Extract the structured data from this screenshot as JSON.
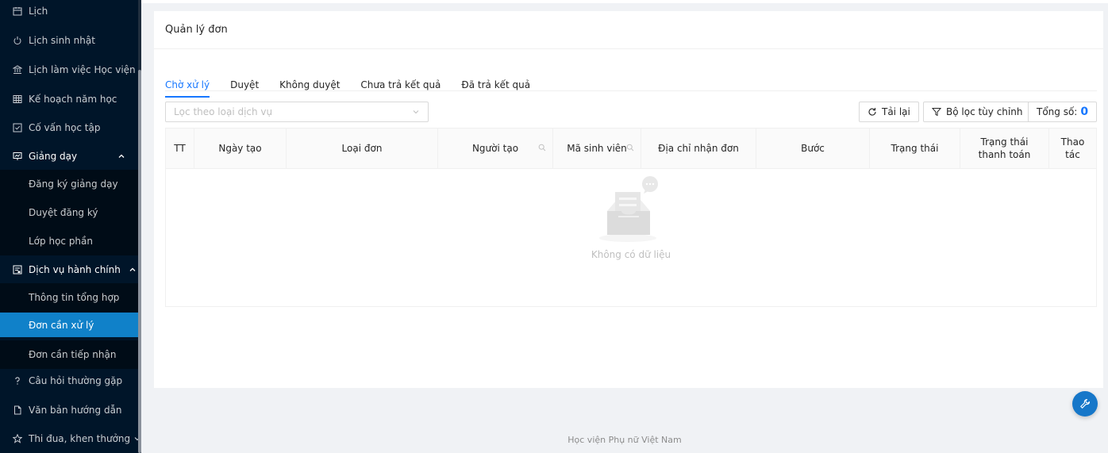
{
  "colors": {
    "sidebar_bg": "#001529",
    "sidebar_active": "#1081c9",
    "accent": "#1677ff"
  },
  "sidebar": {
    "items": [
      {
        "label": "Lịch",
        "icon": "calendar-icon"
      },
      {
        "label": "Lịch sinh nhật",
        "icon": "power-icon"
      },
      {
        "label": "Lịch làm việc Học viện",
        "icon": "bank-icon"
      },
      {
        "label": "Kế hoạch năm học",
        "icon": "table-icon"
      },
      {
        "label": "Cố vấn học tập",
        "icon": "check-square-icon"
      },
      {
        "label": "Giảng dạy",
        "icon": "presentation-icon"
      },
      {
        "label": "Đăng ký giảng dạy"
      },
      {
        "label": "Duyệt đăng ký"
      },
      {
        "label": "Lớp học phần"
      },
      {
        "label": "Dịch vụ hành chính",
        "icon": "form-icon"
      },
      {
        "label": "Thông tin tổng hợp"
      },
      {
        "label": "Đơn cần xử lý"
      },
      {
        "label": "Đơn cần tiếp nhận"
      },
      {
        "label": "Câu hỏi thường gặp",
        "icon": "question-icon"
      },
      {
        "label": "Văn bản hướng dẫn",
        "icon": "file-icon"
      },
      {
        "label": "Thi đua, khen thưởng",
        "icon": "star-icon"
      }
    ]
  },
  "page": {
    "title": "Quản lý đơn",
    "tabs": [
      "Chờ xử lý",
      "Duyệt",
      "Không duyệt",
      "Chưa trả kết quả",
      "Đã trả kết quả"
    ],
    "active_tab": "Chờ xử lý"
  },
  "toolbar": {
    "filter_placeholder": "Lọc theo loại dịch vụ",
    "reload_label": "Tải lại",
    "custom_filter_label": "Bộ lọc tùy chỉnh",
    "total_label": "Tổng số:",
    "total_value": "0"
  },
  "table": {
    "columns": [
      "TT",
      "Ngày tạo",
      "Loại đơn",
      "Người tạo",
      "Mã sinh viên",
      "Địa chỉ nhận đơn",
      "Bước",
      "Trạng thái",
      "Trạng thái thanh toán",
      "Thao tác"
    ],
    "rows": [],
    "empty_text": "Không có dữ liệu"
  },
  "footer": {
    "text": "Học viện Phụ nữ Việt Nam"
  }
}
